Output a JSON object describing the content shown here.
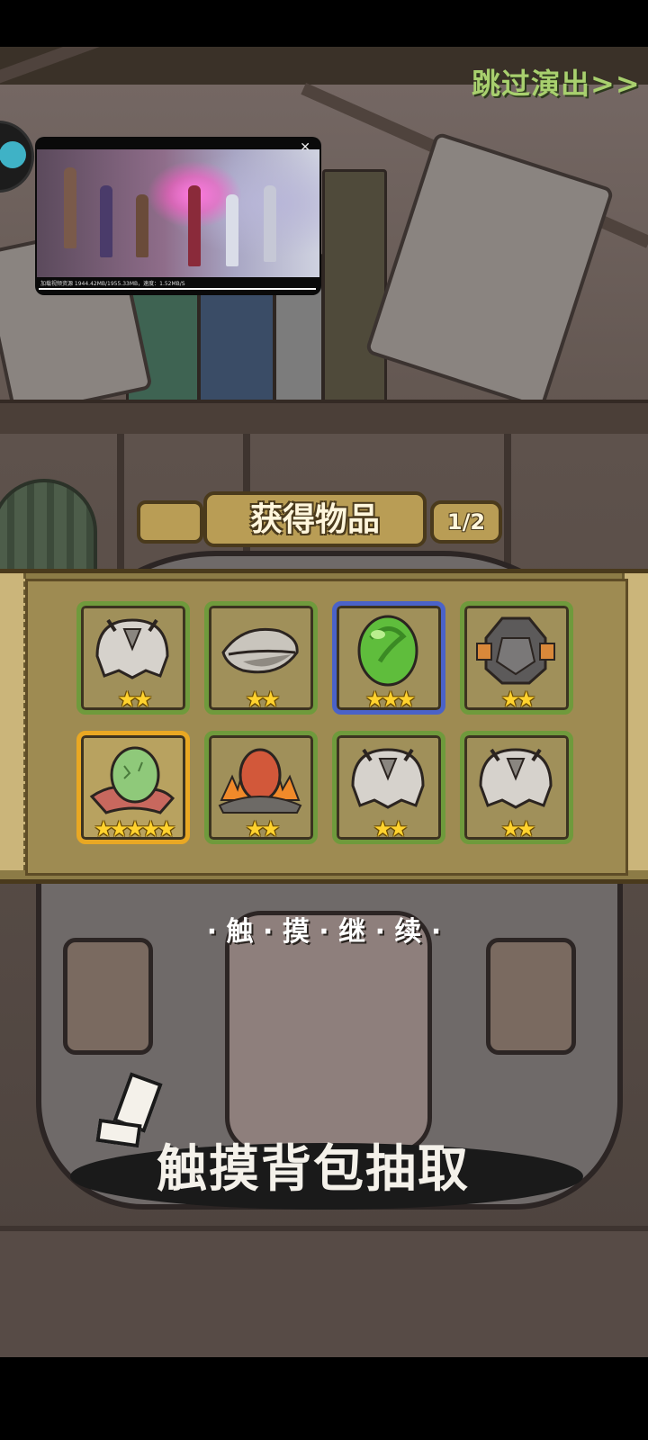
{
  "skip_label": "跳过演出>>",
  "video_overlay": {
    "close_icon": "close-icon",
    "info_text": "加载视频资源 1944.42MB/1955.33MB，速度：1.52MB/S"
  },
  "reward_panel": {
    "title": "获得物品",
    "page_indicator": "1/2",
    "items": [
      {
        "name": "gray-fur-hood",
        "stars": "★★",
        "rarity": 2
      },
      {
        "name": "gray-leaf-seed",
        "stars": "★★",
        "rarity": 2
      },
      {
        "name": "green-egg",
        "stars": "★★★",
        "rarity": 3
      },
      {
        "name": "stone-helmet",
        "stars": "★★",
        "rarity": 2
      },
      {
        "name": "green-egg-on-scarf",
        "stars": "★★★★★",
        "rarity": 5
      },
      {
        "name": "fire-egg-on-coals",
        "stars": "★★",
        "rarity": 2
      },
      {
        "name": "gray-fur-hood",
        "stars": "★★",
        "rarity": 2
      },
      {
        "name": "gray-fur-hood",
        "stars": "★★",
        "rarity": 2
      }
    ]
  },
  "touch_continue": "· 触 · 摸 · 继 · 续 ·",
  "draw_prompt": "触摸背包抽取",
  "colors": {
    "skip": "#a8d06e",
    "slot_green": "#6f9a3c",
    "slot_blue": "#4a62c8",
    "slot_gold": "#e9a823",
    "star": "#ffd22e"
  }
}
